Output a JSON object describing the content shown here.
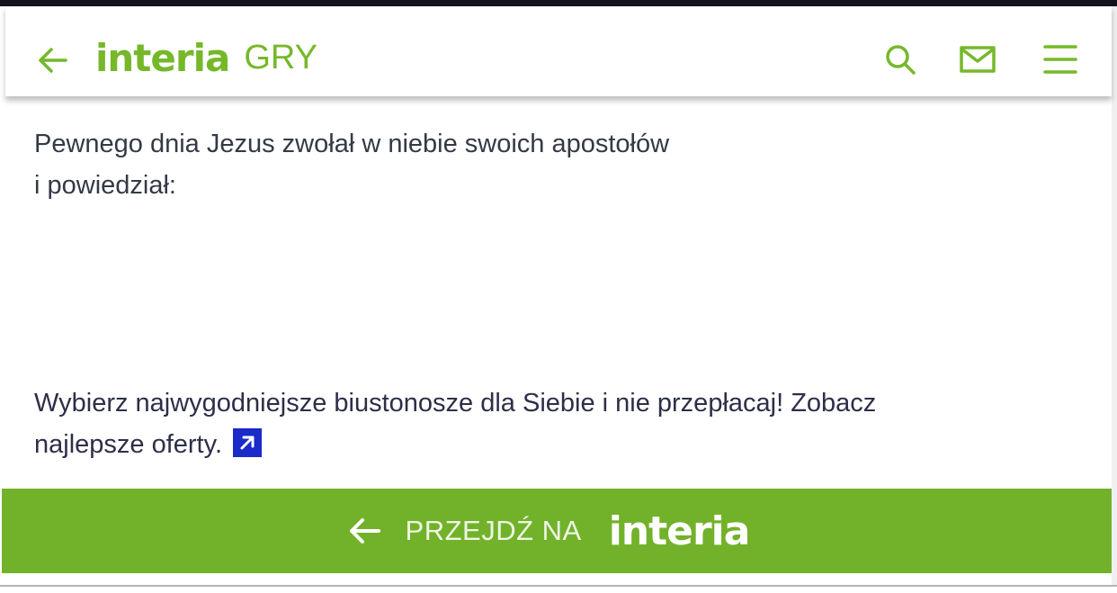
{
  "header": {
    "logo_text": "interia",
    "section": "GRY",
    "icons": {
      "back": "arrow-left-icon",
      "search": "search-icon",
      "mail": "mail-icon",
      "menu": "hamburger-menu-icon"
    }
  },
  "article": {
    "intro_line1": "Pewnego dnia Jezus zwołał w niebie swoich apostołów",
    "intro_line2": "i powiedział:",
    "ad_line1": "Wybierz najwygodniejsze biustonosze dla Siebie i nie przepłacaj! Zobacz",
    "ad_line2": "najlepsze oferty.",
    "ad_link_icon": "external-link-icon"
  },
  "footer": {
    "label": "PRZEJDŹ NA",
    "logo_text": "interia",
    "icon": "arrow-left-icon"
  },
  "colors": {
    "brand_green": "#76b82a",
    "footer_green": "#72b22a",
    "link_blue": "#1a2bc9",
    "text": "#333a45"
  }
}
